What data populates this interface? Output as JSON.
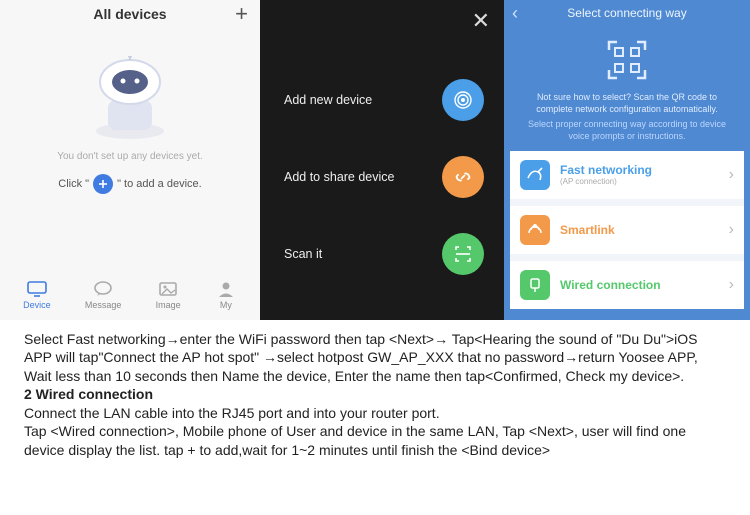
{
  "screen1": {
    "title": "All devices",
    "plus": "+",
    "empty_msg": "You don't set up any devices yet.",
    "hint_pre": "Click \"",
    "hint_post": "\" to add a device.",
    "tabs": [
      {
        "label": "Device"
      },
      {
        "label": "Message"
      },
      {
        "label": "Image"
      },
      {
        "label": "My"
      }
    ]
  },
  "screen2": {
    "rows": [
      {
        "label": "Add new device"
      },
      {
        "label": "Add to share device"
      },
      {
        "label": "Scan it"
      }
    ]
  },
  "screen3": {
    "title": "Select connecting way",
    "help1": "Not sure how to select? Scan the QR code to complete network configuration automatically.",
    "help2": "Select proper connecting way according to device voice prompts or instructions.",
    "items": [
      {
        "title": "Fast networking",
        "sub": "(AP connection)"
      },
      {
        "title": "Smartlink",
        "sub": ""
      },
      {
        "title": "Wired connection",
        "sub": ""
      }
    ]
  },
  "doc": {
    "p1": "Select Fast networking→enter the WiFi password then tap <Next>→ Tap<Hearing the sound of \"Du Du\">iOS APP will tap\"Connect the AP hot spot\" →select hotpost GW_AP_XXX that no password→return Yoosee APP, Wait less than 10 seconds then Name the device, Enter the name then tap<Confirmed, Check my device>.",
    "h2": "2  Wired connection",
    "p2": "Connect the LAN cable into the RJ45 port and into your router port.",
    "p3": "Tap <Wired connection>, Mobile phone of User and device in the same LAN, Tap <Next>, user will find one device display the list. tap + to add,wait for 1~2 minutes until finish the <Bind device>"
  }
}
